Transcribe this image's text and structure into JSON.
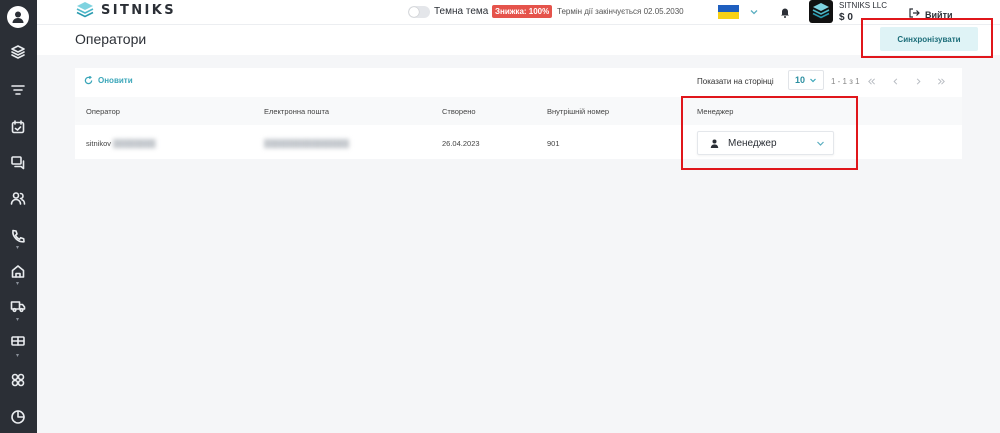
{
  "brand": {
    "name": "SITNIKS"
  },
  "topbar": {
    "theme_label": "Темна тема",
    "discount_badge": "Знижка: 100%",
    "term_text": "Термін дії закінчується 02.05.2030",
    "company_name": "SITNIKS LLC",
    "balance": "$ 0",
    "logout_label": "Вийти"
  },
  "page": {
    "title": "Оператори",
    "sync_button": "Синхронізувати"
  },
  "toolbar": {
    "refresh_label": "Оновити",
    "per_page_label": "Показати на сторінці",
    "per_page_value": "10",
    "page_range": "1 - 1 з 1"
  },
  "table": {
    "columns": [
      "Оператор",
      "Електронна пошта",
      "Створено",
      "Внутрішній номер",
      "Менеджер"
    ],
    "rows": [
      {
        "operator": "sitnikov",
        "email": "",
        "created": "26.04.2023",
        "ext": "901",
        "manager": "Менеджер"
      }
    ]
  },
  "colors": {
    "accent": "#3aa6b9",
    "sidebar": "#2b2f36",
    "highlight": "#e0161b",
    "discount": "#e5534b"
  },
  "icons": [
    "user-avatar-icon",
    "layers-icon",
    "filter-icon",
    "calendar-icon",
    "chat-icon",
    "users-icon",
    "phone-icon",
    "home-icon",
    "truck-icon",
    "ticket-icon",
    "integrations-icon",
    "stats-icon"
  ]
}
